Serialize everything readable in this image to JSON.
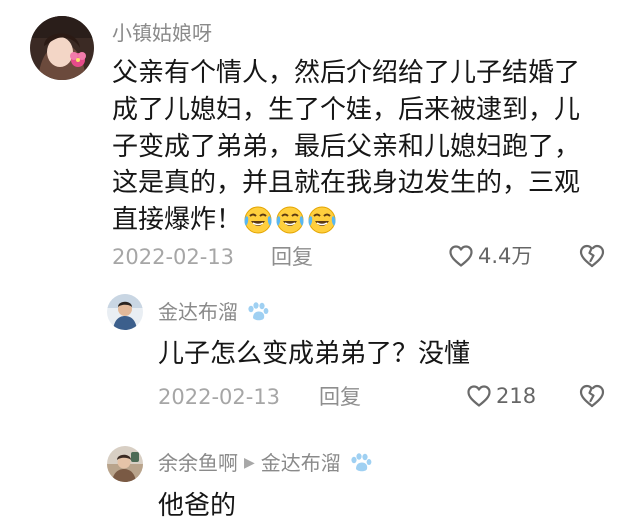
{
  "comments": [
    {
      "username": "小镇姑娘呀",
      "content_lines": [
        "父亲有个情人，然后介绍给了儿子结婚了",
        "成了儿媳妇，生了个娃，后来被逮到，儿",
        "子变成了弟弟，最后父亲和儿媳妇跑了，",
        "这是真的，并且就在我身边发生的，三观",
        "直接爆炸！"
      ],
      "emoji_icons": [
        "crying-laughing-emoji",
        "crying-laughing-emoji",
        "crying-laughing-emoji"
      ],
      "date": "2022-02-13",
      "reply_label": "回复",
      "like_count": "4.4万"
    },
    {
      "username": "金达布溜",
      "content": "儿子怎么变成弟弟了？没懂",
      "date": "2022-02-13",
      "reply_label": "回复",
      "like_count": "218"
    },
    {
      "username": "余余鱼啊",
      "reply_to": "金达布溜",
      "content": "他爸的"
    }
  ],
  "colors": {
    "text": "#161616",
    "muted": "#8a8a8a",
    "meta": "#a6a6a6",
    "paw": "#9fd0f2"
  }
}
